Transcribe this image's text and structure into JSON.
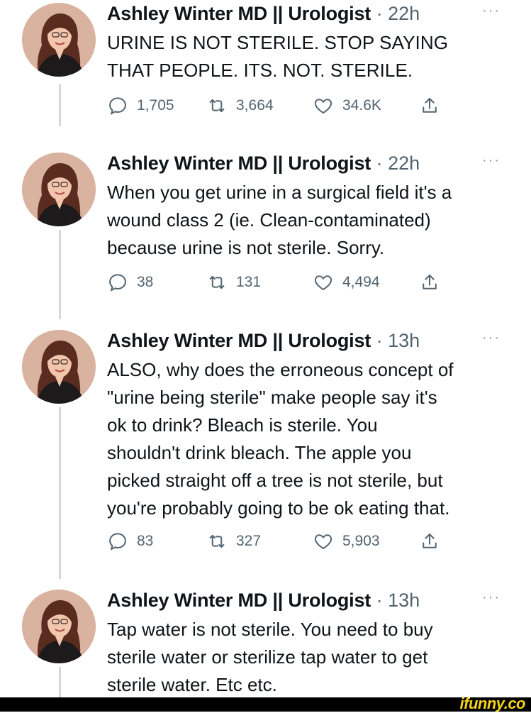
{
  "author": {
    "name": "Ashley Winter MD || Urologist",
    "separator": "·"
  },
  "tweets": [
    {
      "time": "22h",
      "lines": [
        "URINE IS NOT STERILE. STOP SAYING",
        "THAT PEOPLE. ITS. NOT. STERILE."
      ],
      "replies": "1,705",
      "retweets": "3,664",
      "likes": "34.6K"
    },
    {
      "time": "22h",
      "lines": [
        "When you get urine in a surgical field it's a",
        "wound class 2 (ie. Clean-contaminated)",
        "because urine is not sterile. Sorry."
      ],
      "replies": "38",
      "retweets": "131",
      "likes": "4,494"
    },
    {
      "time": "13h",
      "lines": [
        "ALSO, why does the erroneous concept of",
        "\"urine being sterile\" make people say it's",
        "ok to drink? Bleach is sterile. You",
        "shouldn't drink bleach. The apple you",
        "picked straight off a tree is not sterile, but",
        "you're probably going to be ok eating that."
      ],
      "replies": "83",
      "retweets": "327",
      "likes": "5,903"
    },
    {
      "time": "13h",
      "lines": [
        "Tap water is not sterile. You need to buy",
        "sterile water or sterilize tap water to get",
        "sterile water. Etc etc."
      ]
    }
  ],
  "more_label": "···",
  "icons": [
    "reply-icon",
    "retweet-icon",
    "like-icon",
    "share-icon",
    "more-icon"
  ],
  "watermark": "ifunny.co",
  "colors": {
    "text": "#0f1419",
    "muted": "#536471",
    "rail": "#cfd9de",
    "watermark": "#f5d31a"
  }
}
